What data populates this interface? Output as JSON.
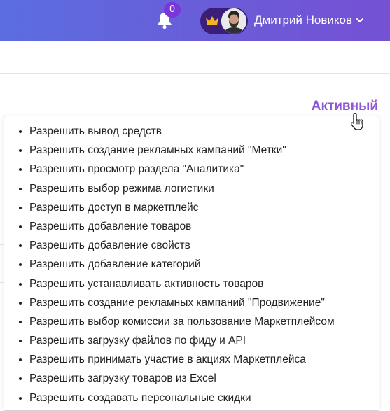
{
  "header": {
    "notifications_count": "0",
    "user_name": "Дмитрий Новиков",
    "crown_color": "#f2b51f",
    "accent_start": "#5b6ee1",
    "accent_end": "#7551d4"
  },
  "permission": {
    "status": "Активный",
    "status_color": "#8d57d6",
    "items": [
      "Разрешить вывод средств",
      "Разрешить создание рекламных кампаний \"Метки\"",
      "Разрешить просмотр раздела \"Аналитика\"",
      "Разрешить выбор режима логистики",
      "Разрешить доступ в маркетплейс",
      "Разрешить добавление товаров",
      "Разрешить добавление свойств",
      "Разрешить добавление категорий",
      "Разрешить устанавливать активность товаров",
      "Разрешить создание рекламных кампаний \"Продвижение\"",
      "Разрешить выбор комиссии за пользование Маркетплейсом",
      "Разрешить загрузку файлов по фиду и API",
      "Разрешить принимать участие в акциях Маркетплейса",
      "Разрешить загрузку товаров из Excel",
      "Разрешить создавать персональные скидки"
    ]
  }
}
